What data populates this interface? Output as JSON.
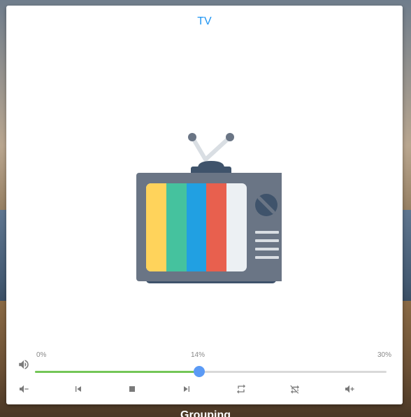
{
  "card": {
    "title": "TV",
    "image_icon": "retro-tv-icon"
  },
  "volume": {
    "icon": "speaker-icon",
    "min_label": "0%",
    "current_label": "14%",
    "max_label": "30%",
    "level_fraction": 0.467,
    "fill_color": "#74c657",
    "thumb_color": "#5b9af5"
  },
  "controls": [
    {
      "name": "volume-down-icon"
    },
    {
      "name": "previous-track-icon"
    },
    {
      "name": "stop-icon"
    },
    {
      "name": "next-track-icon"
    },
    {
      "name": "repeat-icon"
    },
    {
      "name": "repeat-off-icon"
    },
    {
      "name": "volume-up-icon"
    }
  ],
  "background": {
    "label": "Grouping"
  },
  "colors": {
    "title": "#2196f3",
    "tv_body": "#6a7585",
    "tv_stand": "#3f536b",
    "bars": [
      "#ffd35b",
      "#45c29e",
      "#21a0e2",
      "#e8604e",
      "#ecf0f3"
    ]
  }
}
